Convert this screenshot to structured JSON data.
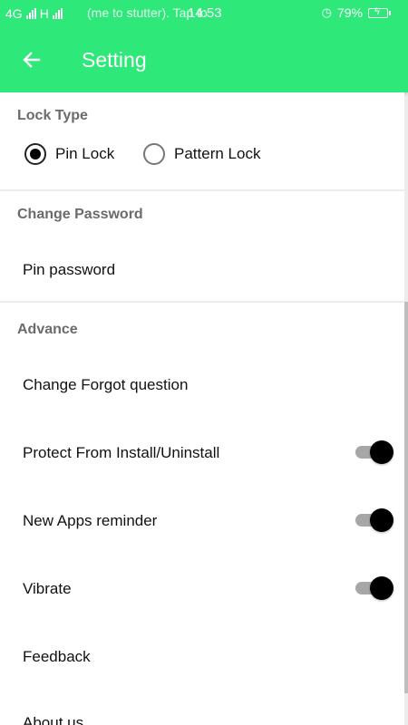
{
  "status_bar": {
    "network": "4G",
    "network2": "H",
    "ticker": "(me to stutter). Tap to",
    "time": "14:53",
    "battery": "79%"
  },
  "appbar": {
    "title": "Setting",
    "back_icon": "arrow-left-icon"
  },
  "lock_type": {
    "title": "Lock Type",
    "options": [
      {
        "label": "Pin Lock",
        "selected": true
      },
      {
        "label": "Pattern Lock",
        "selected": false
      }
    ]
  },
  "change_password": {
    "title": "Change Password",
    "items": [
      "Pin password"
    ]
  },
  "advance": {
    "title": "Advance",
    "items": [
      {
        "label": "Change Forgot question"
      },
      {
        "label": "Protect From Install/Uninstall",
        "toggle": true
      },
      {
        "label": "New Apps reminder",
        "toggle": true
      },
      {
        "label": "Vibrate",
        "toggle": true
      },
      {
        "label": "Feedback"
      },
      {
        "label": "About us"
      }
    ]
  },
  "colors": {
    "accent": "#2ee87a",
    "toggle_knob": "#000000",
    "toggle_track": "#a7a7a7"
  }
}
